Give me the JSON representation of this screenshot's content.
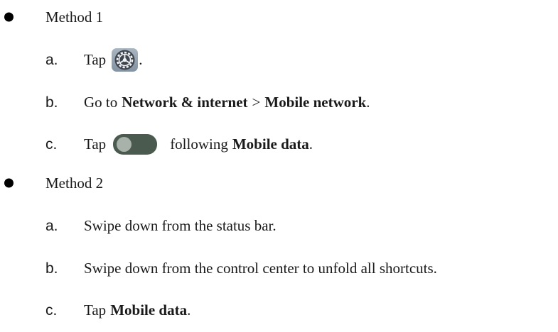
{
  "method1": {
    "title": "Method 1",
    "steps": {
      "a": {
        "letter": "a.",
        "text_before": "Tap",
        "icon": "settings-gear-icon",
        "text_after": "."
      },
      "b": {
        "letter": "b.",
        "text_before": "Go to",
        "bold1": "Network & internet",
        "separator": ">",
        "bold2": "Mobile network",
        "text_after": "."
      },
      "c": {
        "letter": "c.",
        "text_before": "Tap",
        "icon": "toggle-switch-icon",
        "text_mid": "following",
        "bold": "Mobile data",
        "text_after": "."
      }
    }
  },
  "method2": {
    "title": "Method 2",
    "steps": {
      "a": {
        "letter": "a.",
        "text": "Swipe down from the status bar."
      },
      "b": {
        "letter": "b.",
        "text": "Swipe down from the control center to unfold all shortcuts."
      },
      "c": {
        "letter": "c.",
        "text_before": "Tap",
        "bold": "Mobile data",
        "text_after": "."
      }
    }
  },
  "colors": {
    "text": "#1a1a1a",
    "bullet": "#000000",
    "gear_bg": "#8f9dab",
    "toggle_bg": "#4a5a4e",
    "toggle_knob": "#a9b2aa"
  }
}
